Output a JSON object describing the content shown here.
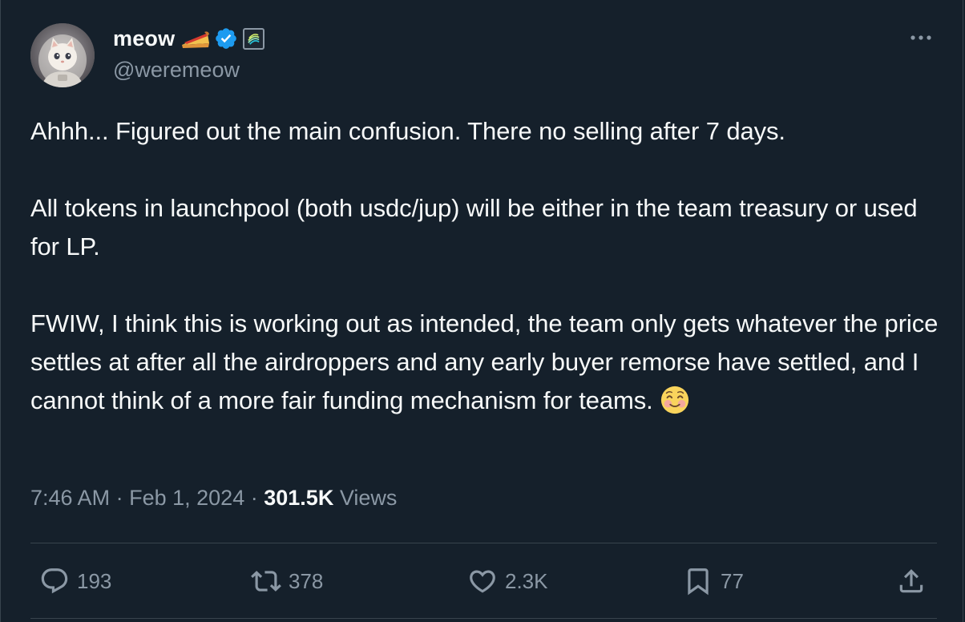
{
  "user": {
    "display_name": "meow",
    "handle": "@weremeow",
    "avatar_icon": "astronaut-cat-avatar",
    "badges": [
      "pie-emoji-icon",
      "verified-badge-icon",
      "affiliate-badge-icon"
    ]
  },
  "tweet": {
    "paragraphs": [
      "Ahhh... Figured out the main confusion. There no selling after 7 days.",
      "All tokens in launchpool (both usdc/jup) will be either in the team treasury or used for LP.",
      "FWIW, I think this is working out as intended, the team only gets whatever the price settles at after all the airdroppers and any early buyer remorse have settled, and I cannot think of a more fair funding mechanism for teams."
    ],
    "emoji": "smiling-face-with-smiling-eyes"
  },
  "meta": {
    "time": "7:46 AM",
    "separator": "·",
    "date": "Feb 1, 2024",
    "views_count": "301.5K",
    "views_label": "Views"
  },
  "actions": {
    "replies": "193",
    "retweets": "378",
    "likes": "2.3K",
    "bookmarks": "77"
  },
  "colors": {
    "background": "#15202b",
    "text": "#f7f9f9",
    "secondary_text": "#8b98a5",
    "border": "#38444d",
    "verified": "#1d9bf0"
  }
}
